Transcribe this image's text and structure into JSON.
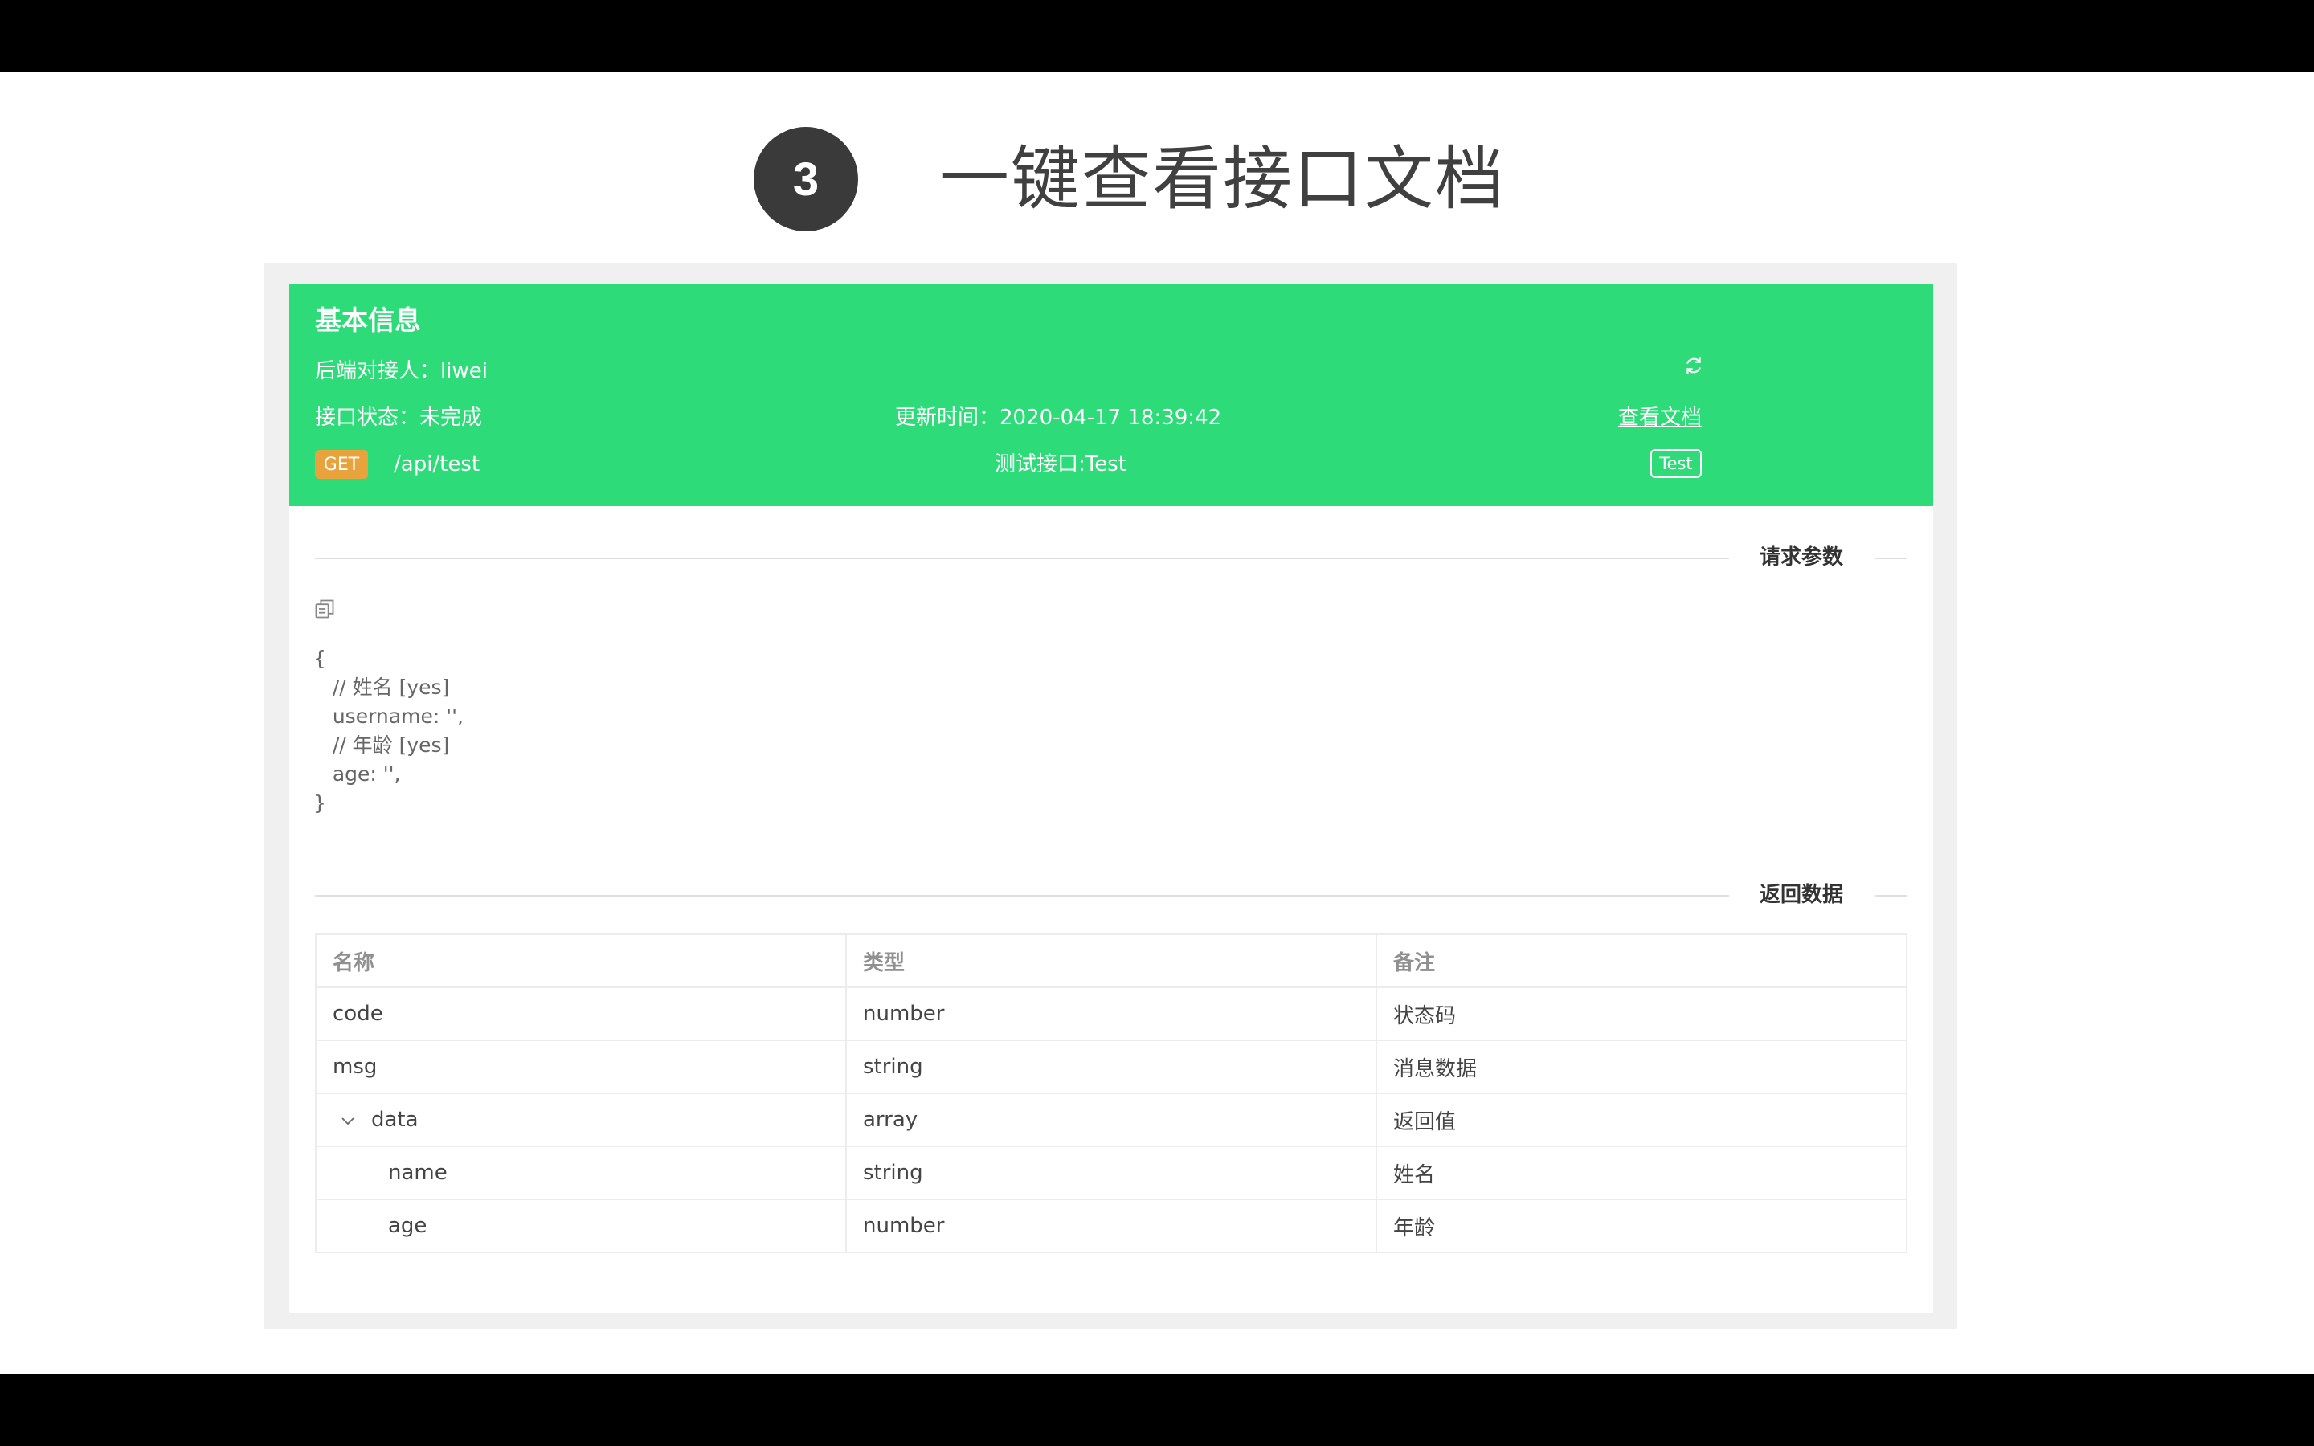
{
  "slide": {
    "step_number": "3",
    "title": "一键查看接口文档"
  },
  "header": {
    "title": "基本信息",
    "owner_label": "后端对接人：",
    "owner": "liwei",
    "status_label": "接口状态：",
    "status": "未完成",
    "updated_label": "更新时间：",
    "updated": "2020-04-17 18:39:42",
    "doc_link": "查看文档",
    "method": "GET",
    "path": "/api/test",
    "api_name": "测试接口:Test",
    "test_button": "Test",
    "icons": [
      "refresh-icon"
    ]
  },
  "request": {
    "section_label": "请求参数",
    "copy_icon": "copy-icon",
    "code": "{\n   // 姓名 [yes]\n   username: '',\n   // 年龄 [yes]\n   age: '',\n}"
  },
  "response": {
    "section_label": "返回数据",
    "columns": [
      "名称",
      "类型",
      "备注"
    ],
    "rows": [
      {
        "name": "code",
        "type": "number",
        "note": "状态码"
      },
      {
        "name": "msg",
        "type": "string",
        "note": "消息数据"
      },
      {
        "name": "data",
        "type": "array",
        "note": "返回值"
      },
      {
        "name": "name",
        "type": "string",
        "note": "姓名"
      },
      {
        "name": "age",
        "type": "number",
        "note": "年龄"
      }
    ]
  },
  "colors": {
    "header_bg": "#2edb79",
    "method_badge": "#e8a33d",
    "step_circle": "#3a3a3a"
  }
}
